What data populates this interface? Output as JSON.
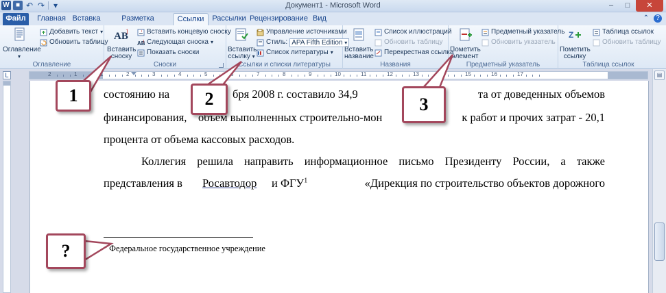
{
  "window": {
    "title": "Документ1  -  Microsoft Word",
    "minimize": "–",
    "maximize": "□",
    "close": "✕"
  },
  "qat": {
    "app_icon": "W",
    "save_icon": "■",
    "undo_icon": "↶",
    "redo_icon": "↷",
    "customize_icon": "▾"
  },
  "tabs": [
    {
      "label": "Файл"
    },
    {
      "label": "Главная"
    },
    {
      "label": "Вставка"
    },
    {
      "label": "Разметка страницы"
    },
    {
      "label": "Ссылки"
    },
    {
      "label": "Рассылки"
    },
    {
      "label": "Рецензирование"
    },
    {
      "label": "Вид"
    }
  ],
  "ribbon": {
    "toc": {
      "group_label": "Оглавление",
      "toc_button": "Оглавление",
      "add_text": "Добавить текст",
      "update_table": "Обновить таблицу"
    },
    "footnotes": {
      "group_label": "Сноски",
      "insert_footnote_l1": "Вставить",
      "insert_footnote_l2": "сноску",
      "insert_endnote": "Вставить концевую сноску",
      "next_footnote": "Следующая сноска",
      "show_notes": "Показать сноски"
    },
    "citations": {
      "group_label": "Ссылки и списки литературы",
      "insert_citation_l1": "Вставить",
      "insert_citation_l2": "ссылку",
      "manage_sources": "Управление источниками",
      "style_label": "Стиль:",
      "style_value": "APA Fifth Edition",
      "bibliography": "Список литературы"
    },
    "captions": {
      "group_label": "Названия",
      "insert_caption_l1": "Вставить",
      "insert_caption_l2": "название",
      "table_of_figures": "Список иллюстраций",
      "update_table": "Обновить таблицу",
      "cross_reference": "Перекрестная ссылка"
    },
    "index": {
      "group_label": "Предметный указатель",
      "mark_entry_l1": "Пометить",
      "mark_entry_l2": "элемент",
      "insert_index": "Предметный указатель",
      "update_index": "Обновить указатель"
    },
    "authorities": {
      "group_label": "Таблица ссылок",
      "mark_citation_l1": "Пометить",
      "mark_citation_l2": "ссылку",
      "insert_table": "Таблица ссылок",
      "update_table": "Обновить таблицу"
    }
  },
  "ruler": {
    "tab_selector": "L",
    "numbers": [
      "2",
      "1",
      "1",
      "2",
      "3",
      "4",
      "5",
      "6",
      "7",
      "8",
      "9",
      "10",
      "11",
      "12",
      "13",
      "14",
      "15",
      "16",
      "17"
    ]
  },
  "document": {
    "line1_a": "состоянию на",
    "line1_b": "бря 2008 г. составило 34,9",
    "line1_c": "та от доведенных объемов",
    "line2_a": "финансирования,",
    "line2_b": "объем выполненных строительно-мон",
    "line2_c": "к работ и прочих затрат - 20,1",
    "line3": "процента от объема кассовых расходов.",
    "line4": "Коллегия решила направить информационное письмо Президенту России, а также",
    "line5_a": "представления в",
    "line5_link": "Росавтодор",
    "line5_b": "и ФГУ",
    "line5_sup": "1",
    "line5_c": "«Дирекция по строительство объектов дорожного",
    "footnote_num": "1",
    "footnote_text": "Федеральное государственное учреждение"
  },
  "callouts": {
    "c1": "1",
    "c2": "2",
    "c3": "3",
    "cq": "?"
  }
}
